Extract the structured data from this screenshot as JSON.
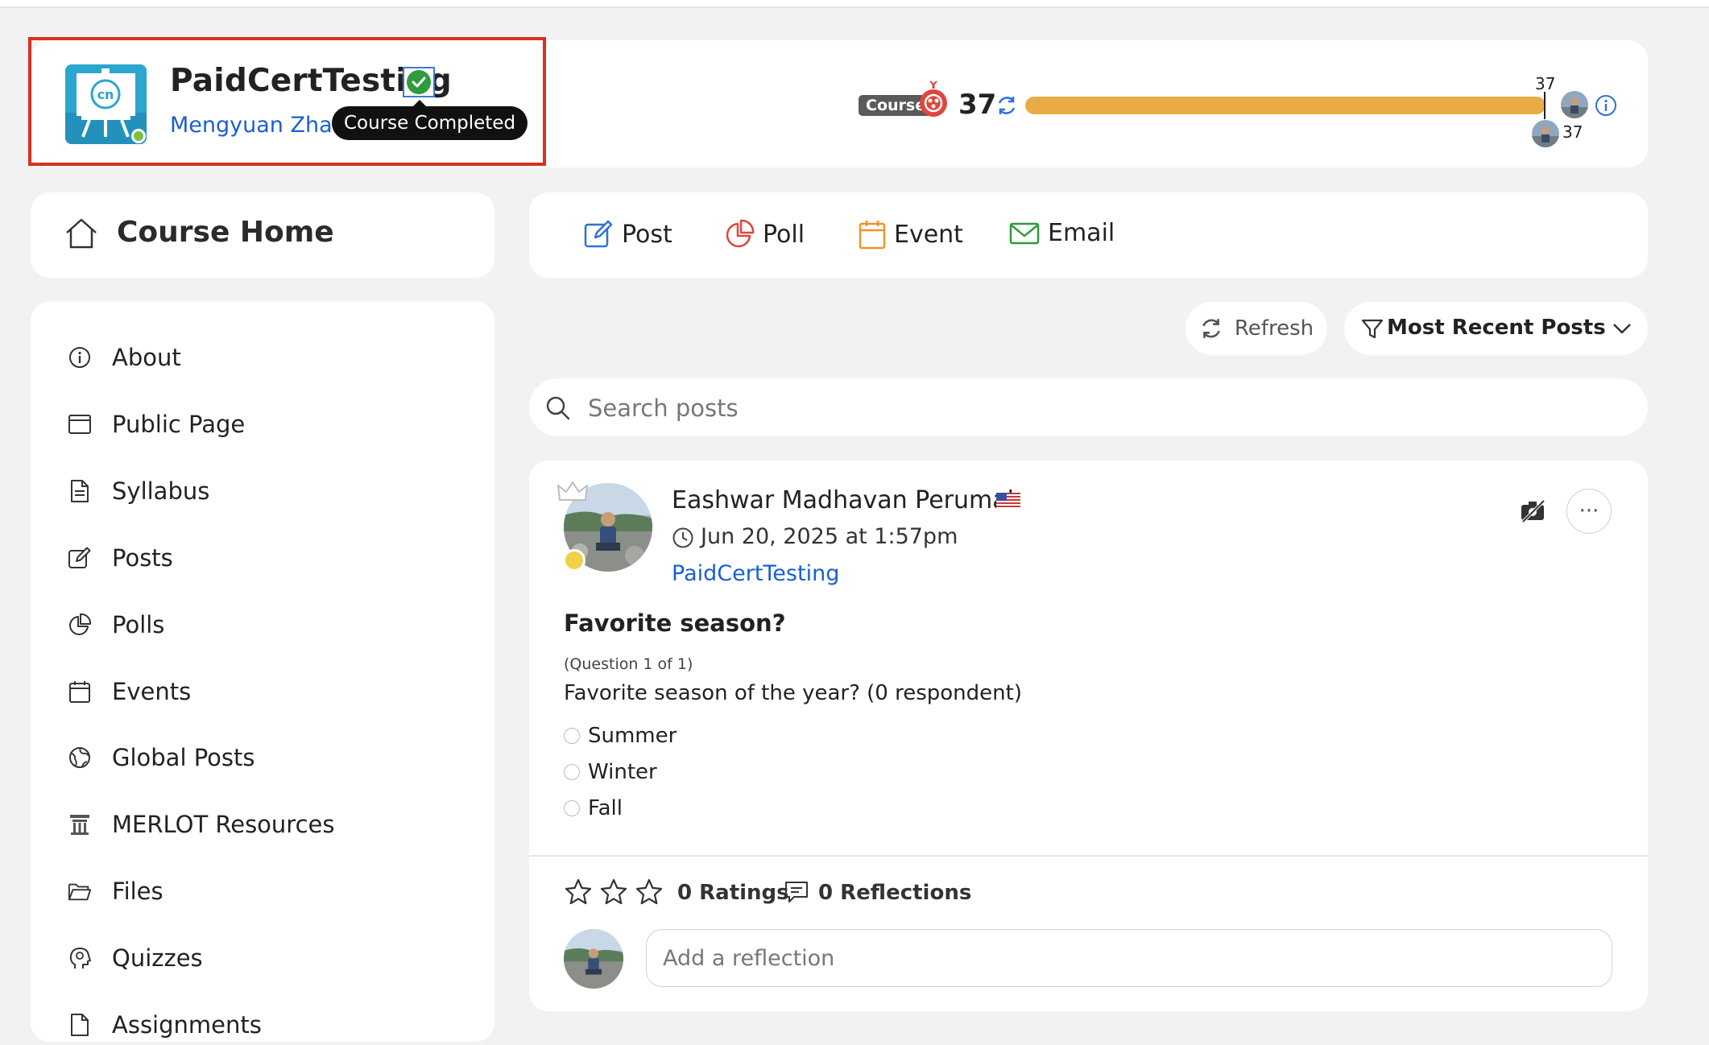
{
  "header": {
    "course_title": "PaidCertTesting",
    "instructor": "Mengyuan Zhao",
    "tooltip": "Course Completed",
    "badge_label": "Course",
    "score": "37",
    "progress_fraction": 1.0,
    "progress_top_label": "37",
    "progress_bottom_label": "37"
  },
  "course_home": {
    "label": "Course Home"
  },
  "compose": {
    "post": "Post",
    "poll": "Poll",
    "event": "Event",
    "email": "Email"
  },
  "sidebar": {
    "items": [
      {
        "label": "About",
        "icon": "info-icon"
      },
      {
        "label": "Public Page",
        "icon": "browser-window-icon"
      },
      {
        "label": "Syllabus",
        "icon": "document-icon"
      },
      {
        "label": "Posts",
        "icon": "edit-icon"
      },
      {
        "label": "Polls",
        "icon": "pie-chart-icon"
      },
      {
        "label": "Events",
        "icon": "calendar-icon"
      },
      {
        "label": "Global Posts",
        "icon": "globe-icon"
      },
      {
        "label": "MERLOT Resources",
        "icon": "merlot-icon"
      },
      {
        "label": "Files",
        "icon": "folder-icon"
      },
      {
        "label": "Quizzes",
        "icon": "brain-head-icon"
      },
      {
        "label": "Assignments",
        "icon": "document-icon"
      }
    ]
  },
  "controls": {
    "refresh": "Refresh",
    "sort": "Most Recent Posts",
    "search_placeholder": "Search posts"
  },
  "post": {
    "author": "Eashwar Madhavan Perumal",
    "date": "Jun 20, 2025 at 1:57pm",
    "course": "PaidCertTesting",
    "title": "Favorite season?",
    "question_counter": "(Question 1 of 1)",
    "question": "Favorite season of the year? (0 respondent)",
    "options": [
      "Summer",
      "Winter",
      "Fall"
    ],
    "more": "···",
    "ratings": "0 Ratings",
    "reflections": "0 Reflections",
    "reflection_placeholder": "Add a reflection"
  },
  "colors": {
    "accent_link": "#1a5fd1",
    "progress_fill": "#e9ac44",
    "highlight_border": "#d9311f",
    "completed_green": "#2e9c3a"
  }
}
